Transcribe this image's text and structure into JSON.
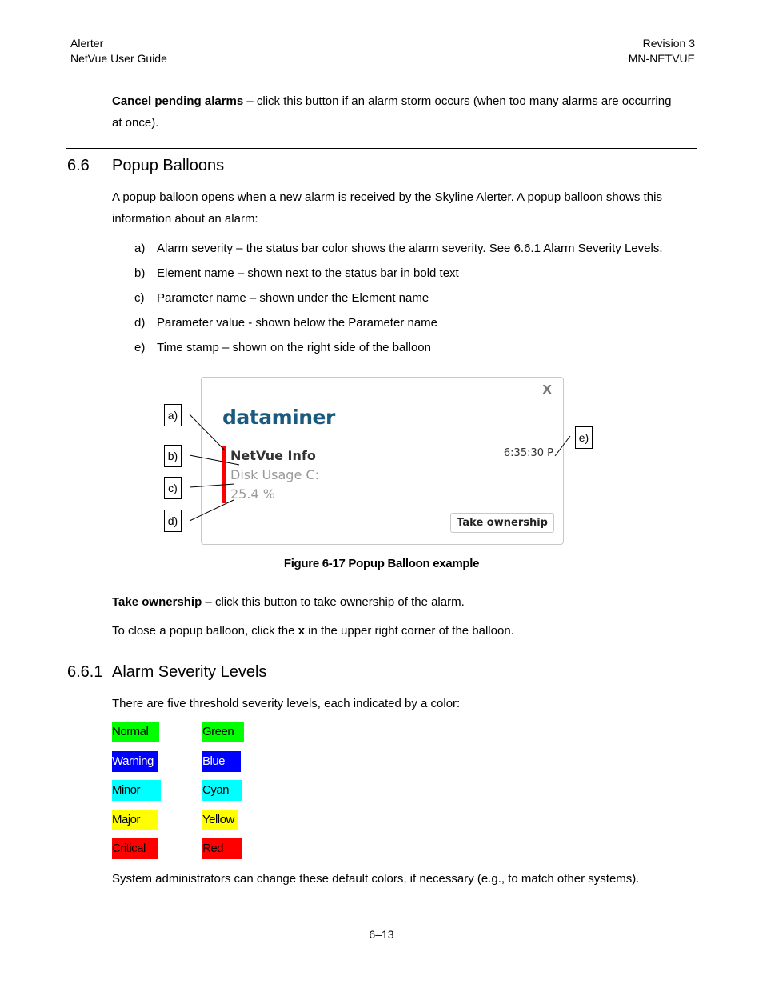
{
  "header": {
    "left_line1": "Alerter",
    "left_line2": "NetVue User Guide",
    "right_line1": "Revision 3",
    "right_line2": "MN-NETVUE"
  },
  "intro": {
    "term": "Cancel pending alarms",
    "text": " – click this button if an alarm storm occurs (when too many alarms are occurring",
    "text2": "at once)."
  },
  "section": {
    "number": "6.6",
    "title": "Popup Balloons",
    "para1": "A popup balloon opens when a new alarm is received by the Skyline Alerter. A popup balloon shows this",
    "para2": "information about an alarm:",
    "items": [
      {
        "label": "a)",
        "text": "Alarm severity – the status bar color shows the alarm severity. See 6.6.1 Alarm Severity Levels."
      },
      {
        "label": "b)",
        "text": "Element name – shown next to the status bar in bold text"
      },
      {
        "label": "c)",
        "text": "Parameter name – shown under the Element name"
      },
      {
        "label": "d)",
        "text": "Parameter value  - shown below the Parameter name"
      },
      {
        "label": "e)",
        "text": "Time stamp – shown on the right side of the balloon"
      }
    ]
  },
  "figure": {
    "close": "X",
    "logo": "dataminer",
    "element_name": "NetVue Info",
    "parameter_name": "Disk Usage C:",
    "parameter_value": "25.4 %",
    "timestamp": "6:35:30 P",
    "button": "Take ownership",
    "severity_color": "#ff0000",
    "callouts": [
      "a)",
      "b)",
      "c)",
      "d)",
      "e)"
    ],
    "caption": "Figure 6-17 Popup Balloon example"
  },
  "after": {
    "term": "Take ownership",
    "text": " – click this button to take ownership of the alarm.",
    "close_pre": "To close a popup balloon, click the ",
    "close_x": "x",
    "close_post": " in the upper right corner of the balloon."
  },
  "subsection": {
    "number": "6.6.1",
    "title": "Alarm Severity Levels",
    "intro": "There are five threshold severity levels, each indicated by a color:",
    "levels": [
      {
        "name": "Normal",
        "color_name": "Green",
        "color": "#00ff00",
        "text_color": "#000000"
      },
      {
        "name": "Warning",
        "color_name": "Blue",
        "color": "#0000ff",
        "text_color": "#ffffff"
      },
      {
        "name": "Minor",
        "color_name": "Cyan",
        "color": "#00ffff",
        "text_color": "#000000"
      },
      {
        "name": "Major",
        "color_name": "Yellow",
        "color": "#ffff00",
        "text_color": "#000000"
      },
      {
        "name": "Critical",
        "color_name": "Red",
        "color": "#ff0000",
        "text_color": "#000000"
      }
    ],
    "footer_text": "System administrators can change these default colors, if necessary (e.g., to match other systems)."
  },
  "page_number": "6–13"
}
